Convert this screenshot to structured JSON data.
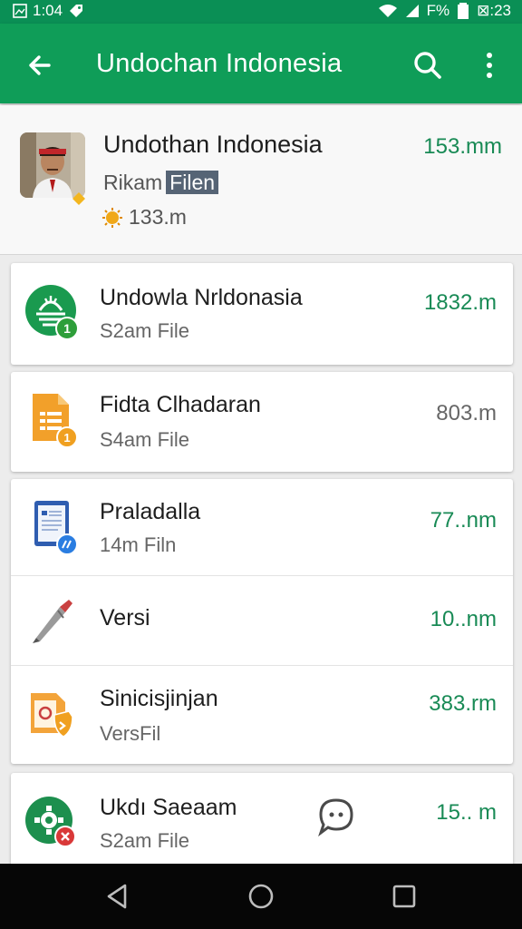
{
  "status": {
    "time": "1:04",
    "battery": "F%",
    "clock": "⊠:23"
  },
  "appbar": {
    "title": "Undochan Indonesia"
  },
  "header": {
    "name": "Undothan Indonesia",
    "subtitle": "Rikam",
    "tag": "Filen",
    "meta": "133.m",
    "size": "153.mm"
  },
  "files": [
    {
      "name": "Undowla Nrldonasia",
      "sub": "S2am File",
      "size": "1832.m",
      "size_color": "#188a55",
      "icon": "green-logo-icon"
    },
    {
      "name": "Fidta Clhadaran",
      "sub": "S4am File",
      "size": "803.m",
      "size_color": "#666666",
      "icon": "orange-doc-icon"
    },
    {
      "name": "Praladalla",
      "sub": "14m Filn",
      "size": "77..nm",
      "size_color": "#188a55",
      "icon": "blue-doc-icon"
    },
    {
      "name": "Versi",
      "sub": "",
      "size": "10..nm",
      "size_color": "#188a55",
      "icon": "pen-icon"
    },
    {
      "name": "Sinicisjinjan",
      "sub": "VersFil",
      "size": "383.rm",
      "size_color": "#188a55",
      "icon": "orange-shield-doc-icon"
    },
    {
      "name": "Ukdı Saeaam",
      "sub": "S2am File",
      "size": "15.. m",
      "size_color": "#188a55",
      "icon": "green-gear-icon"
    }
  ]
}
